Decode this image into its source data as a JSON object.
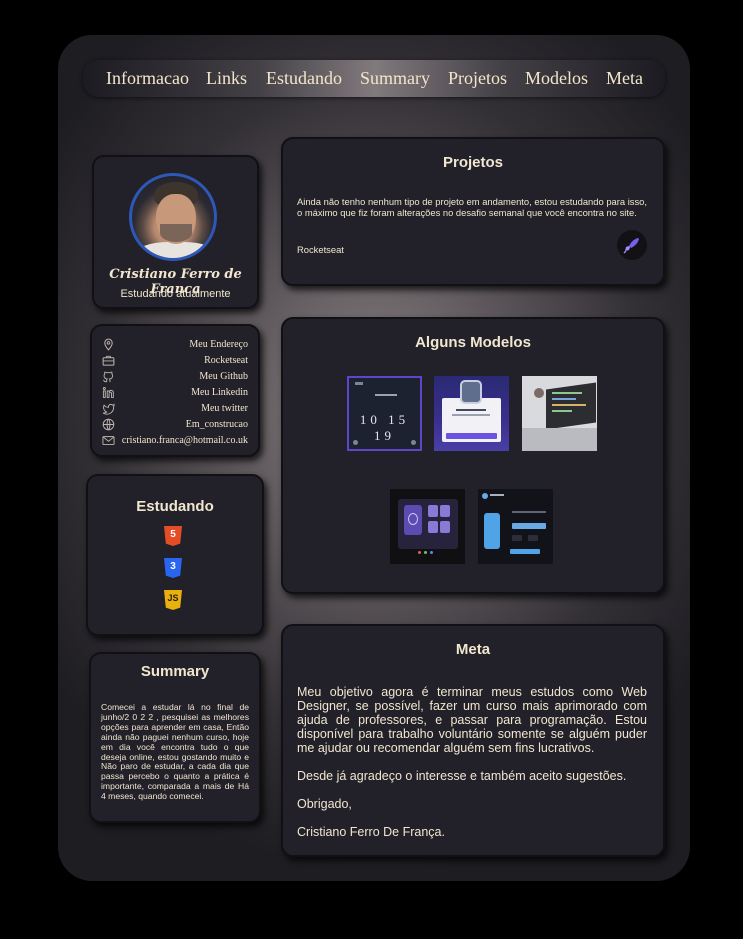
{
  "nav": {
    "items": [
      "Informacao",
      "Links",
      "Estudando",
      "Summary",
      "Projetos",
      "Modelos",
      "Meta"
    ]
  },
  "profile": {
    "name": "Cristiano Ferro de Franca",
    "status": "Estudando atualmente"
  },
  "links": [
    {
      "icon": "location-pin-icon",
      "label": "Meu Endereço"
    },
    {
      "icon": "briefcase-icon",
      "label": "Rocketseat"
    },
    {
      "icon": "github-icon",
      "label": "Meu Github"
    },
    {
      "icon": "linkedin-icon",
      "label": "Meu Linkedin"
    },
    {
      "icon": "twitter-icon",
      "label": "Meu twitter"
    },
    {
      "icon": "globe-icon",
      "label": "Em_construcao"
    },
    {
      "icon": "mail-icon",
      "label": "cristiano.franca@hotmail.co.uk"
    }
  ],
  "studying": {
    "title": "Estudando",
    "badges": [
      {
        "icon": "html5-icon",
        "text": "5",
        "color": "#e44d26"
      },
      {
        "icon": "css3-icon",
        "text": "3",
        "color": "#2965f1"
      },
      {
        "icon": "javascript-icon",
        "text": "JS",
        "color": "#e8b10e"
      }
    ]
  },
  "summary": {
    "title": "Summary",
    "text": "Comecei a estudar lá no final de junho/2 0 2 2 , pesquisei as melhores opções para aprender em casa, Então ainda não paguei nenhum curso, hoje em dia você encontra tudo o que deseja online, estou gostando muito e Não paro de estudar, a cada dia que passa percebo o quanto a prática é importante, comparada a mais de Há 4 meses, quando comecei."
  },
  "projects": {
    "title": "Projetos",
    "text": "Ainda não tenho nenhum tipo de projeto em andamento, estou estudando para isso, o máximo que fiz foram alterações no desafio semanal que você encontra no site.",
    "link": "Rocketseat",
    "icon": "rocket-icon"
  },
  "models": {
    "title": "Alguns Modelos",
    "thumbs": [
      {
        "name": "countdown-model-thumb",
        "numbers": [
          "10",
          "15",
          "19"
        ]
      },
      {
        "name": "smartwatch-model-thumb"
      },
      {
        "name": "code-laptop-model-thumb"
      },
      {
        "name": "fingerprint-app-model-thumb"
      },
      {
        "name": "water-app-model-thumb"
      }
    ]
  },
  "meta": {
    "title": "Meta",
    "paragraphs": [
      "Meu objetivo agora é terminar meus estudos como Web Designer, se possível, fazer um curso mais aprimorado com ajuda de professores, e passar para programação. Estou disponível para trabalho voluntário somente se alguém puder me ajudar ou recomendar alguém sem fins lucrativos.",
      "Desde já agradeço o interesse e também aceito sugestões.",
      "Obrigado,",
      "Cristiano Ferro De França."
    ]
  },
  "colors": {
    "text": "#f1e6cf",
    "card": "#222129",
    "accent_purple": "#6c4fd8"
  }
}
